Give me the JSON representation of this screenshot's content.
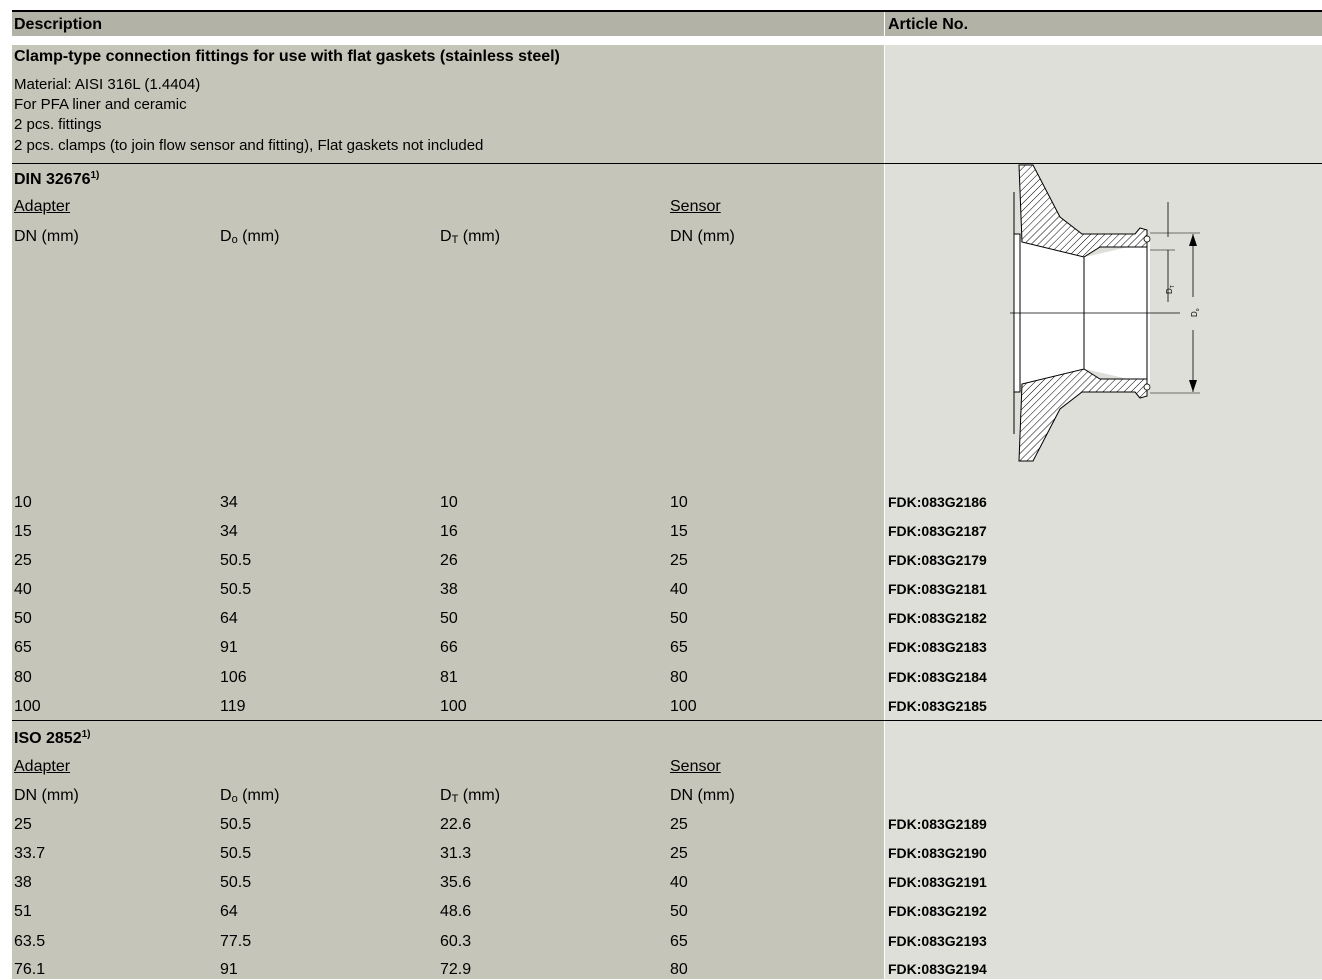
{
  "header": {
    "description": "Description",
    "article_no": "Article No."
  },
  "section": {
    "title": "Clamp-type connection fittings for use with flat gaskets (stainless steel)",
    "notes": [
      "Material: AISI 316L (1.4404)",
      "For PFA liner and ceramic",
      "2 pcs. fittings",
      "2 pcs. clamps (to join flow sensor and fitting), Flat gaskets not included"
    ]
  },
  "columns": {
    "adapter": "Adapter",
    "sensor": "Sensor",
    "dn": "DN (mm)",
    "do_main": "D",
    "do_sub": "o",
    "dt_main": "D",
    "dt_sub": "T",
    "mm": " (mm)",
    "sensor_dn": "DN (mm)"
  },
  "din": {
    "title": "DIN 32676",
    "footnote": "1)",
    "rows": [
      {
        "dn": "10",
        "do": "34",
        "dt": "10",
        "sensor": "10",
        "article": "FDK:083G2186"
      },
      {
        "dn": "15",
        "do": "34",
        "dt": "16",
        "sensor": "15",
        "article": "FDK:083G2187"
      },
      {
        "dn": "25",
        "do": "50.5",
        "dt": "26",
        "sensor": "25",
        "article": "FDK:083G2179"
      },
      {
        "dn": "40",
        "do": "50.5",
        "dt": "38",
        "sensor": "40",
        "article": "FDK:083G2181"
      },
      {
        "dn": "50",
        "do": "64",
        "dt": "50",
        "sensor": "50",
        "article": "FDK:083G2182"
      },
      {
        "dn": "65",
        "do": "91",
        "dt": "66",
        "sensor": "65",
        "article": "FDK:083G2183"
      },
      {
        "dn": "80",
        "do": "106",
        "dt": "81",
        "sensor": "80",
        "article": "FDK:083G2184"
      },
      {
        "dn": "100",
        "do": "119",
        "dt": "100",
        "sensor": "100",
        "article": "FDK:083G2185"
      }
    ]
  },
  "iso": {
    "title": "ISO 2852",
    "footnote": "1)",
    "rows": [
      {
        "dn": "25",
        "do": "50.5",
        "dt": "22.6",
        "sensor": "25",
        "article": "FDK:083G2189"
      },
      {
        "dn": "33.7",
        "do": "50.5",
        "dt": "31.3",
        "sensor": "25",
        "article": "FDK:083G2190"
      },
      {
        "dn": "38",
        "do": "50.5",
        "dt": "35.6",
        "sensor": "40",
        "article": "FDK:083G2191"
      },
      {
        "dn": "51",
        "do": "64",
        "dt": "48.6",
        "sensor": "50",
        "article": "FDK:083G2192"
      },
      {
        "dn": "63.5",
        "do": "77.5",
        "dt": "60.3",
        "sensor": "65",
        "article": "FDK:083G2193"
      },
      {
        "dn": "76.1",
        "do": "91",
        "dt": "72.9",
        "sensor": "80",
        "article": "FDK:083G2194"
      }
    ]
  },
  "drawing": {
    "label_dt": "D",
    "label_dt_sub": "T",
    "label_do": "D",
    "label_do_sub": "o"
  }
}
